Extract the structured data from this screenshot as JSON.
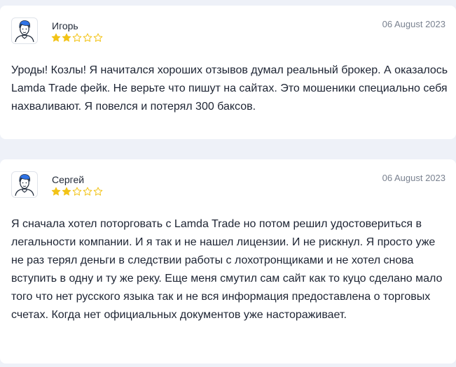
{
  "reviews": [
    {
      "author": "Игорь",
      "date": "06 August 2023",
      "rating": 2,
      "max_rating": 5,
      "text": "Уроды! Козлы! Я начитался хороших отзывов думал реальный брокер. А оказалось Lamda Trade фейк. Не верьте что пишут на сайтах. Это мошеники специально себя нахваливают. Я повелся и потерял 300 баксов."
    },
    {
      "author": "Сергей",
      "date": "06 August 2023",
      "rating": 2,
      "max_rating": 5,
      "text": "Я сначала хотел поторговать с Lamda Trade но потом решил удостовериться в легальности компании. И я так и не нашел лицензии. И не рискнул. Я просто уже не раз терял деньги в следствии работы с лохотронщиками и не хотел снова вступить в одну и ту же реку. Еще меня смутил сам сайт как то куцо сделано мало того что нет русского языка так и не вся информация предоставлена о торговых счетах. Когда нет официальных документов уже настораживает."
    }
  ],
  "colors": {
    "star_filled": "#f2c317",
    "star_empty": "#f2c317",
    "avatar_hair": "#2f73e6",
    "page_background": "#eef1f8",
    "card_background": "#ffffff"
  },
  "icons": {
    "avatar": "user-avatar-icon",
    "star_filled": "star-filled-icon",
    "star_empty": "star-outline-icon"
  }
}
